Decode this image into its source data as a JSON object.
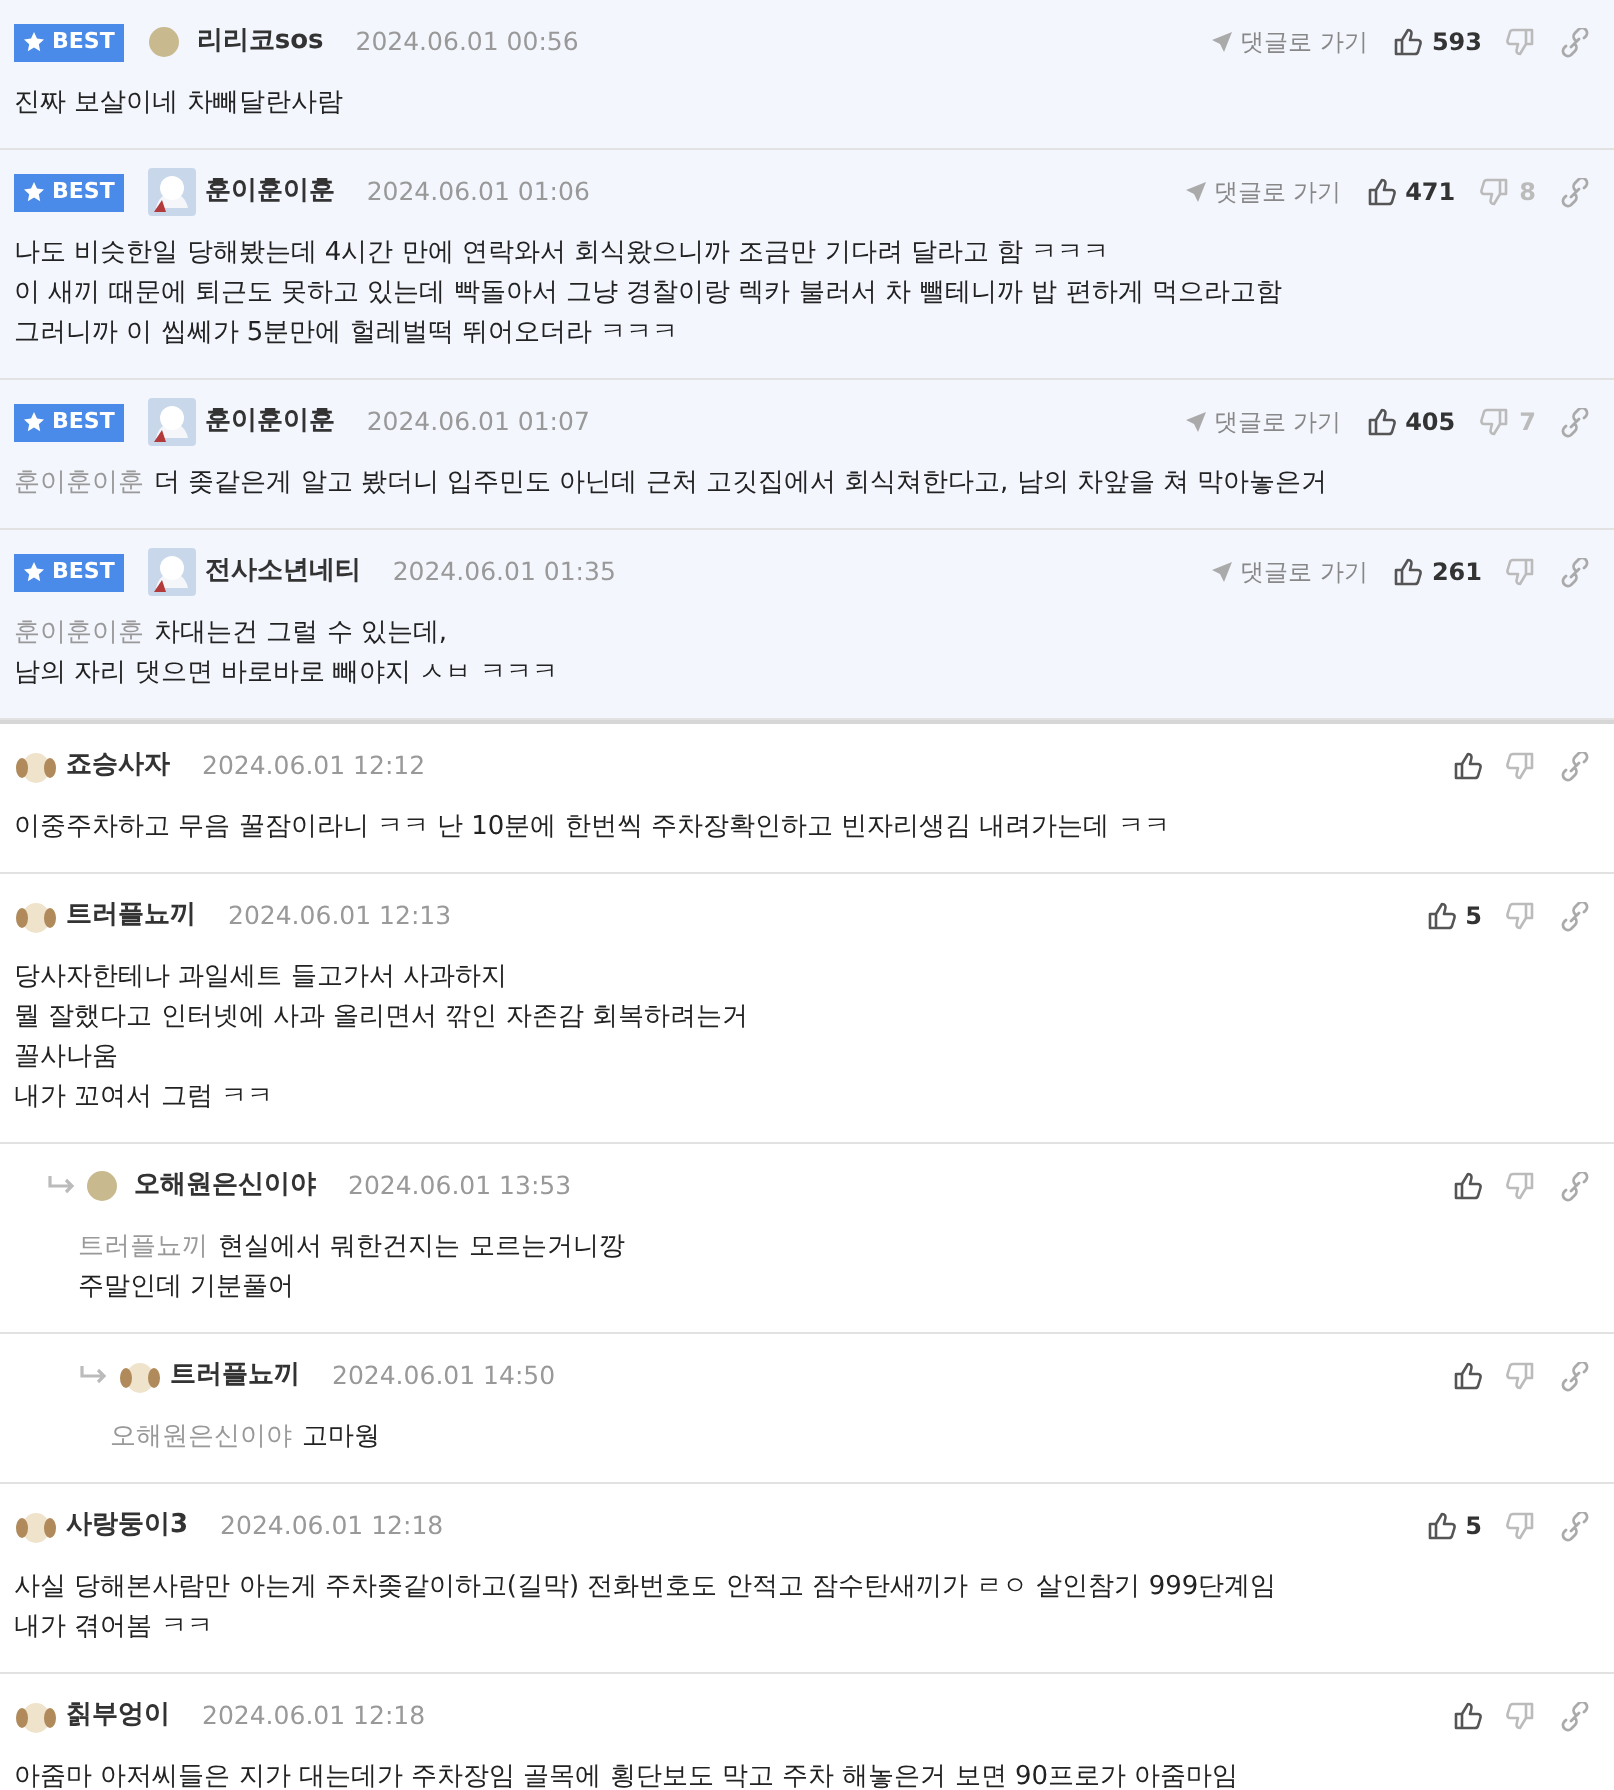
{
  "comments": [
    {
      "badge": "BEST",
      "avatar": {
        "kind": "dot"
      },
      "user": "리리코sos",
      "datetime": "2024.06.01 00:56",
      "goto": "댓글로 가기",
      "likes": "593",
      "lines": [
        "진짜 보살이네 차빼달란사람"
      ]
    },
    {
      "badge": "BEST",
      "avatar": {
        "kind": "photo"
      },
      "user": "훈이훈이훈",
      "datetime": "2024.06.01 01:06",
      "goto": "댓글로 가기",
      "likes": "471",
      "dislikes": "8",
      "lines": [
        "나도 비슷한일 당해봤는데 4시간 만에 연락와서 회식왔으니까 조금만 기다려 달라고 함 ㅋㅋㅋ",
        "이 새끼 때문에 퇴근도 못하고 있는데 빡돌아서 그냥 경찰이랑 렉카 불러서 차 뺄테니까 밥 편하게 먹으라고함",
        "그러니까 이 씹쎄가 5분만에 헐레벌떡 뛰어오더라 ㅋㅋㅋ"
      ]
    },
    {
      "badge": "BEST",
      "avatar": {
        "kind": "photo"
      },
      "user": "훈이훈이훈",
      "datetime": "2024.06.01 01:07",
      "goto": "댓글로 가기",
      "likes": "405",
      "dislikes": "7",
      "mention": "훈이훈이훈",
      "lines": [
        "더 좆같은게 알고 봤더니 입주민도 아닌데 근처 고깃집에서 회식쳐한다고, 남의 차앞을 쳐 막아놓은거"
      ]
    },
    {
      "badge": "BEST",
      "avatar": {
        "kind": "photo"
      },
      "user": "전사소년네티",
      "datetime": "2024.06.01 01:35",
      "goto": "댓글로 가기",
      "likes": "261",
      "mention": "훈이훈이훈",
      "lines": [
        "차대는건 그럴 수 있는데,",
        "남의 자리 댓으면 바로바로 빼야지 ㅅㅂ ㅋㅋㅋ"
      ]
    },
    {
      "avatar": {
        "kind": "dog"
      },
      "user": "죠승사자",
      "datetime": "2024.06.01 12:12",
      "lines": [
        "이중주차하고 무음 꿀잠이라니 ㅋㅋ 난 10분에 한번씩 주차장확인하고 빈자리생김 내려가는데 ㅋㅋ"
      ]
    },
    {
      "avatar": {
        "kind": "dog"
      },
      "user": "트러플뇨끼",
      "datetime": "2024.06.01 12:13",
      "likes": "5",
      "lines": [
        "당사자한테나 과일세트 들고가서 사과하지",
        "뭘 잘했다고 인터넷에 사과 올리면서 깎인 자존감 회복하려는거",
        "꼴사나움",
        "내가 꼬여서 그럼 ㅋㅋ"
      ],
      "children": [
        {
          "avatar": {
            "kind": "dot"
          },
          "user": "오해원은신이야",
          "datetime": "2024.06.01 13:53",
          "mention": "트러플뇨끼",
          "lines": [
            "현실에서 뭐한건지는 모르는거니깡",
            "주말인데 기분풀어"
          ],
          "children": [
            {
              "avatar": {
                "kind": "dog"
              },
              "user": "트러플뇨끼",
              "datetime": "2024.06.01 14:50",
              "mention": "오해원은신이야",
              "lines": [
                "고마웡"
              ]
            }
          ]
        }
      ]
    },
    {
      "avatar": {
        "kind": "dog"
      },
      "user": "사랑둥이3",
      "datetime": "2024.06.01 12:18",
      "likes": "5",
      "lines": [
        "사실 당해본사람만 아는게 주차좆같이하고(길막) 전화번호도 안적고 잠수탄새끼가 ㄹㅇ 살인참기 999단계임",
        "내가 겪어봄 ㅋㅋ"
      ]
    },
    {
      "avatar": {
        "kind": "dog"
      },
      "user": "칡부엉이",
      "datetime": "2024.06.01 12:18",
      "lines": [
        "아줌마 아저씨들은 지가 대는데가 주차장임 골목에 횡단보도 막고 주차 해놓은거 보면 90프로가 아줌마임"
      ]
    }
  ]
}
